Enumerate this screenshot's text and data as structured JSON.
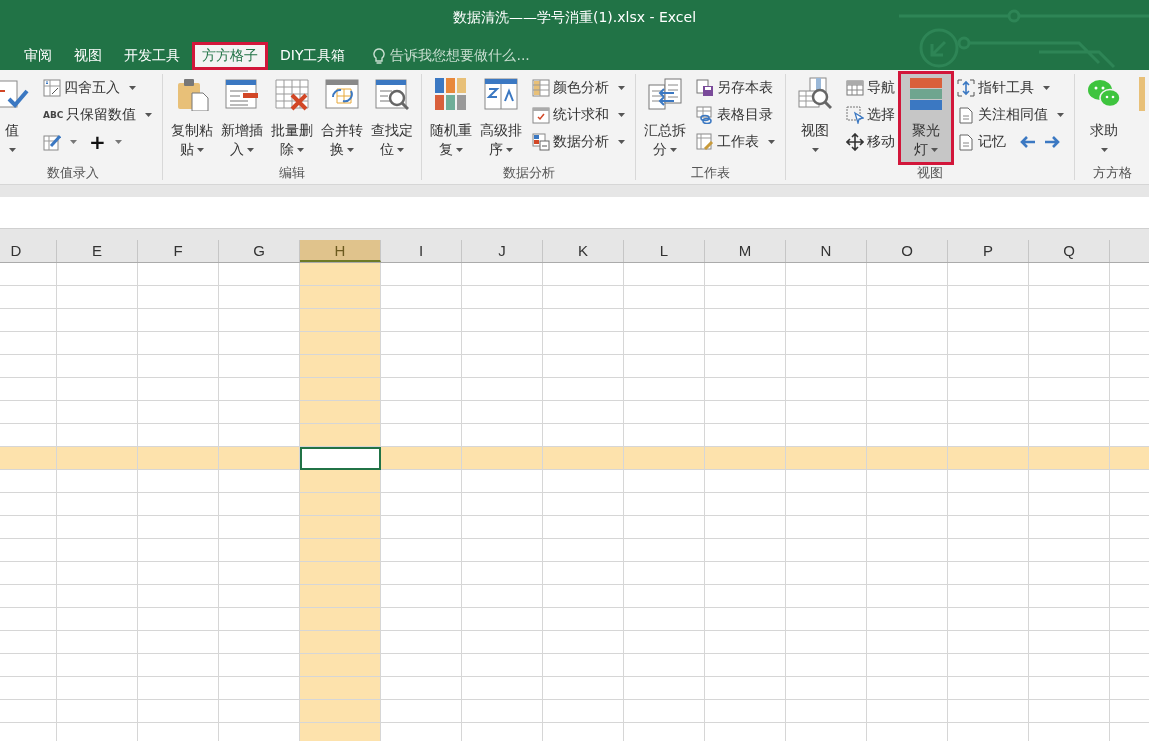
{
  "window": {
    "title": "数据清洗——学号消重(1).xlsx - Excel"
  },
  "tabs": [
    {
      "label": "审阅",
      "selected": false,
      "annotated": false
    },
    {
      "label": "视图",
      "selected": false,
      "annotated": false
    },
    {
      "label": "开发工具",
      "selected": false,
      "annotated": false
    },
    {
      "label": "方方格子",
      "selected": true,
      "annotated": true
    },
    {
      "label": "DIY工具箱",
      "selected": false,
      "annotated": false
    }
  ],
  "tell_me": {
    "placeholder": "告诉我您想要做什么..."
  },
  "ribbon": {
    "groups": [
      {
        "label": "数值录入",
        "items": [
          {
            "kind": "large",
            "lines": [
              "值"
            ],
            "dropdown": true,
            "pressed": false,
            "annotated": false
          },
          {
            "kind": "stack",
            "rows": [
              {
                "kind": "item",
                "label": "四舍五入",
                "dropdown": true
              },
              {
                "kind": "item",
                "icon_text": "ABC",
                "label": "只保留数值",
                "dropdown": true
              },
              {
                "kind": "pair",
                "label": "+",
                "dropdown": true
              }
            ]
          }
        ]
      },
      {
        "label": "编辑",
        "items": [
          {
            "kind": "large",
            "lines": [
              "复制粘",
              "贴"
            ],
            "dropdown": true,
            "pressed": false,
            "annotated": false
          },
          {
            "kind": "large",
            "lines": [
              "新增插",
              "入"
            ],
            "dropdown": true,
            "pressed": false,
            "annotated": false
          },
          {
            "kind": "large",
            "lines": [
              "批量删",
              "除"
            ],
            "dropdown": true,
            "pressed": false,
            "annotated": false
          },
          {
            "kind": "large",
            "lines": [
              "合并转",
              "换"
            ],
            "dropdown": true,
            "pressed": false,
            "annotated": false
          },
          {
            "kind": "large",
            "lines": [
              "查找定",
              "位"
            ],
            "dropdown": true,
            "pressed": false,
            "annotated": false
          }
        ]
      },
      {
        "label": "数据分析",
        "items": [
          {
            "kind": "large",
            "lines": [
              "随机重",
              "复"
            ],
            "dropdown": true,
            "pressed": false,
            "annotated": false
          },
          {
            "kind": "large",
            "lines": [
              "高级排",
              "序"
            ],
            "dropdown": true,
            "pressed": false,
            "annotated": false
          },
          {
            "kind": "stack",
            "rows": [
              {
                "kind": "item",
                "label": "颜色分析",
                "dropdown": true
              },
              {
                "kind": "item",
                "label": "统计求和",
                "dropdown": true
              },
              {
                "kind": "item",
                "label": "数据分析",
                "dropdown": true
              }
            ]
          }
        ]
      },
      {
        "label": "工作表",
        "items": [
          {
            "kind": "large",
            "lines": [
              "汇总拆",
              "分"
            ],
            "dropdown": true,
            "pressed": false,
            "annotated": false
          },
          {
            "kind": "stack",
            "rows": [
              {
                "kind": "item",
                "label": "另存本表",
                "dropdown": false
              },
              {
                "kind": "item",
                "label": "表格目录",
                "dropdown": false
              },
              {
                "kind": "item",
                "label": "工作表",
                "dropdown": true
              }
            ]
          }
        ]
      },
      {
        "label": "视图",
        "items": [
          {
            "kind": "large",
            "lines": [
              "视图"
            ],
            "dropdown": true,
            "pressed": false,
            "annotated": false
          },
          {
            "kind": "stack",
            "rows": [
              {
                "kind": "item",
                "label": "导航",
                "dropdown": false
              },
              {
                "kind": "item",
                "label": "选择",
                "dropdown": false
              },
              {
                "kind": "item",
                "label": "移动",
                "dropdown": false
              }
            ]
          },
          {
            "kind": "large",
            "lines": [
              "聚光",
              "灯"
            ],
            "dropdown": true,
            "pressed": true,
            "annotated": true
          },
          {
            "kind": "stack",
            "rows": [
              {
                "kind": "item",
                "label": "指针工具",
                "dropdown": true
              },
              {
                "kind": "item",
                "label": "关注相同值",
                "dropdown": true
              },
              {
                "kind": "memory",
                "label": "记忆",
                "dropdown": false
              }
            ]
          }
        ]
      },
      {
        "label": "方方格",
        "items": [
          {
            "kind": "large",
            "lines": [
              "求助"
            ],
            "dropdown": true,
            "pressed": false,
            "annotated": false
          },
          {
            "kind": "partial"
          }
        ]
      }
    ]
  },
  "sheet": {
    "columns": [
      {
        "label": "D",
        "selected": false
      },
      {
        "label": "E",
        "selected": false
      },
      {
        "label": "F",
        "selected": false
      },
      {
        "label": "G",
        "selected": false
      },
      {
        "label": "H",
        "selected": true
      },
      {
        "label": "I",
        "selected": false
      },
      {
        "label": "J",
        "selected": false
      },
      {
        "label": "K",
        "selected": false
      },
      {
        "label": "L",
        "selected": false
      },
      {
        "label": "M",
        "selected": false
      },
      {
        "label": "N",
        "selected": false
      },
      {
        "label": "O",
        "selected": false
      },
      {
        "label": "P",
        "selected": false
      },
      {
        "label": "Q",
        "selected": false
      }
    ],
    "rows": [
      {
        "selected": false
      },
      {
        "selected": false
      },
      {
        "selected": false
      },
      {
        "selected": false
      },
      {
        "selected": false
      },
      {
        "selected": false
      },
      {
        "selected": false
      },
      {
        "selected": false
      },
      {
        "selected": true
      },
      {
        "selected": false
      },
      {
        "selected": false
      },
      {
        "selected": false
      },
      {
        "selected": false
      },
      {
        "selected": false
      },
      {
        "selected": false
      },
      {
        "selected": false
      },
      {
        "selected": false
      },
      {
        "selected": false
      },
      {
        "selected": false
      },
      {
        "selected": false
      },
      {
        "selected": false
      }
    ]
  }
}
